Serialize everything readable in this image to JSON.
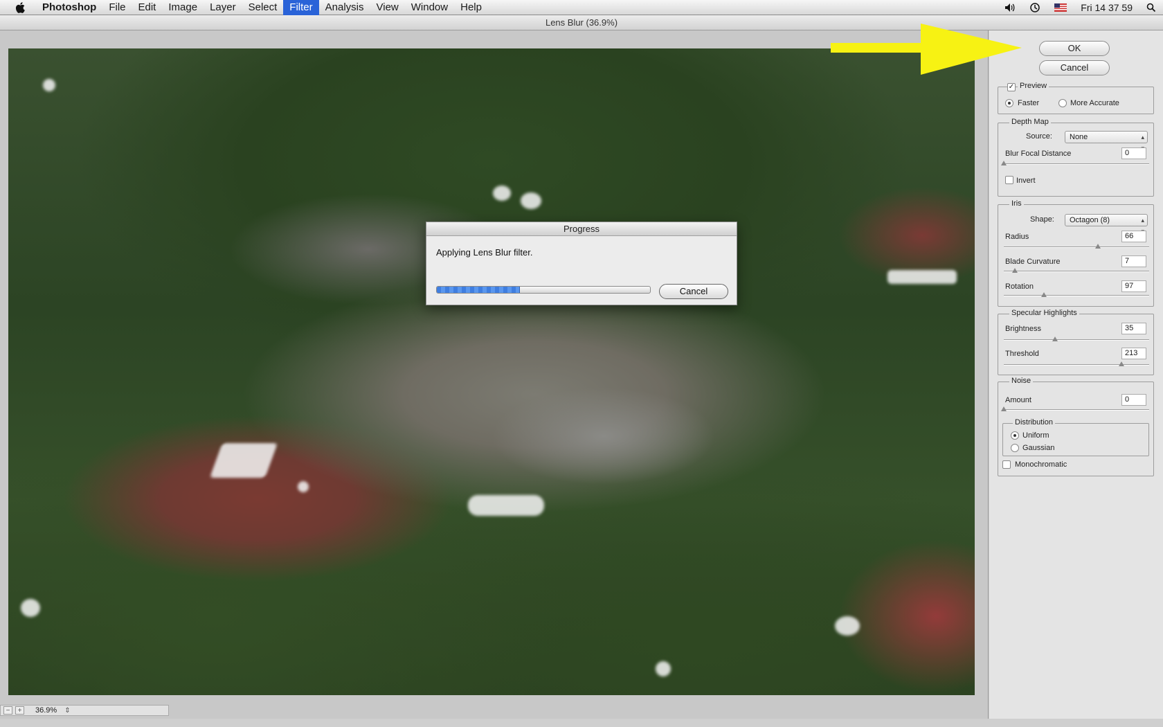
{
  "menubar": {
    "app": "Photoshop",
    "items": [
      "File",
      "Edit",
      "Image",
      "Layer",
      "Select",
      "Filter",
      "Analysis",
      "View",
      "Window",
      "Help"
    ],
    "active": "Filter",
    "clock": "Fri 14 37 59"
  },
  "window": {
    "title": "Lens Blur (36.9%)"
  },
  "statusbar": {
    "zoom": "36.9%"
  },
  "buttons": {
    "ok": "OK",
    "cancel": "Cancel"
  },
  "preview": {
    "label": "Preview",
    "checked": true,
    "faster": "Faster",
    "more_accurate": "More Accurate",
    "selected": "Faster"
  },
  "depth_map": {
    "title": "Depth Map",
    "source_label": "Source:",
    "source_value": "None",
    "blur_focal_label": "Blur Focal Distance",
    "blur_focal_value": "0",
    "invert_label": "Invert"
  },
  "iris": {
    "title": "Iris",
    "shape_label": "Shape:",
    "shape_value": "Octagon (8)",
    "radius_label": "Radius",
    "radius_value": "66",
    "blade_label": "Blade Curvature",
    "blade_value": "7",
    "rotation_label": "Rotation",
    "rotation_value": "97"
  },
  "specular": {
    "title": "Specular Highlights",
    "brightness_label": "Brightness",
    "brightness_value": "35",
    "threshold_label": "Threshold",
    "threshold_value": "213"
  },
  "noise": {
    "title": "Noise",
    "amount_label": "Amount",
    "amount_value": "0",
    "distribution_title": "Distribution",
    "uniform": "Uniform",
    "gaussian": "Gaussian",
    "selected": "Uniform",
    "mono_label": "Monochromatic"
  },
  "progress": {
    "title": "Progress",
    "message": "Applying Lens Blur filter.",
    "cancel": "Cancel",
    "fraction": 0.39
  },
  "colors": {
    "accent": "#2a63d8",
    "arrow": "#f7f213"
  }
}
